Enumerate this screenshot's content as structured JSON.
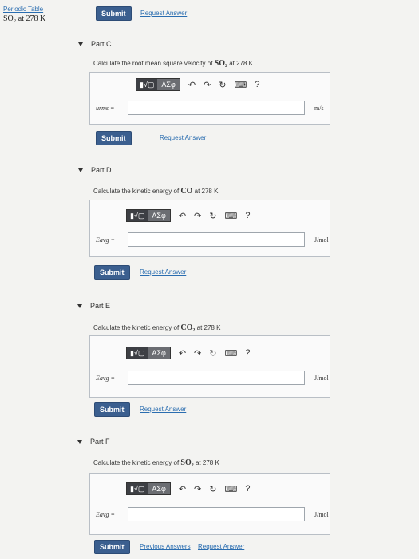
{
  "header": {
    "periodic_table": "Periodic Table",
    "context": "SO₂ at 278 K"
  },
  "top_actions": {
    "submit": "Submit",
    "request": "Request Answer"
  },
  "parts": [
    {
      "title": "Part C",
      "question_prefix": "Calculate the root mean square velocity of ",
      "chem": "SO₂",
      "question_suffix": " at 278 K",
      "var": "urms =",
      "unit": "m/s",
      "submit": "Submit",
      "request": "Request Answer"
    },
    {
      "title": "Part D",
      "question_prefix": "Calculate the kinetic energy of ",
      "chem": "CO",
      "question_suffix": " at 278 K",
      "var": "Eavg =",
      "unit": "J/mol",
      "submit": "Submit",
      "request": "Request Answer"
    },
    {
      "title": "Part E",
      "question_prefix": "Calculate the kinetic energy of ",
      "chem": "CO₂",
      "question_suffix": " at 278 K",
      "var": "Eavg =",
      "unit": "J/mol",
      "submit": "Submit",
      "request": "Request Answer"
    },
    {
      "title": "Part F",
      "question_prefix": "Calculate the kinetic energy of ",
      "chem": "SO₂",
      "question_suffix": " at 278 K",
      "var": "Eavg =",
      "unit": "J/mol",
      "submit": "Submit",
      "previous": "Previous Answers",
      "request": "Request Answer"
    }
  ],
  "toolbar": {
    "templates": "▮√▢",
    "symbols": "ΑΣφ",
    "undo": "↶",
    "redo": "↷",
    "reset": "↻",
    "keyboard": "⌨",
    "help": "?"
  }
}
